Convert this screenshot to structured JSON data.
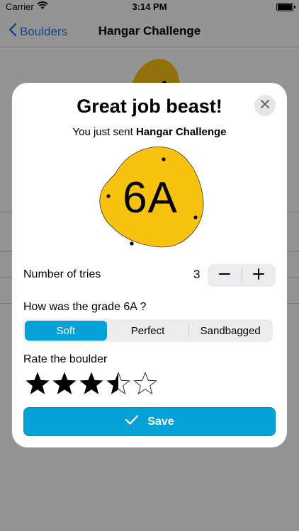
{
  "status_bar": {
    "carrier": "Carrier",
    "time": "3:14 PM"
  },
  "nav": {
    "back_label": "Boulders",
    "title": "Hangar Challenge"
  },
  "modal": {
    "headline": "Great job beast!",
    "subline_prefix": "You just sent ",
    "boulder_name": "Hangar Challenge",
    "grade": "6A",
    "grade_blob_color": "#f8c20e",
    "tries_label": "Number of tries",
    "tries_value": "3",
    "grade_question": "How was the grade 6A ?",
    "grade_options": [
      "Soft",
      "Perfect",
      "Sandbagged"
    ],
    "grade_selected": "Soft",
    "rate_label": "Rate the boulder",
    "rating": 3.5,
    "rating_max": 5,
    "save_label": "Save"
  },
  "colors": {
    "accent": "#04a2d6",
    "nav_blue": "#1a7cf5"
  },
  "icons": [
    "wifi-icon",
    "battery-icon",
    "chevron-left-icon",
    "close-icon",
    "minus-icon",
    "plus-icon",
    "star-icon",
    "checkmark-icon"
  ]
}
